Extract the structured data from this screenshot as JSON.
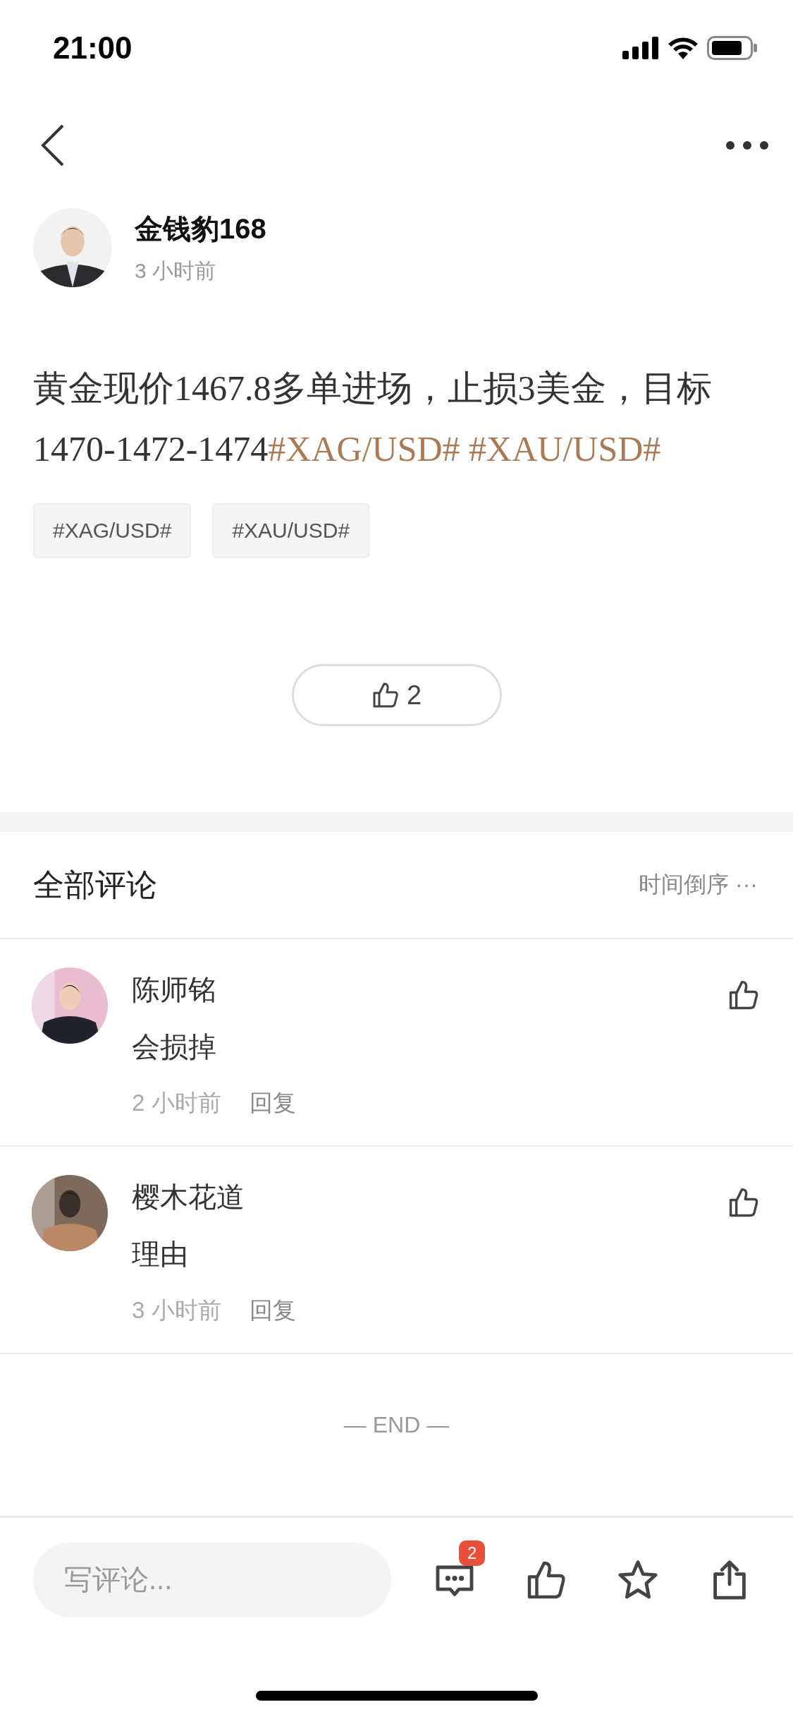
{
  "status_bar": {
    "time": "21:00"
  },
  "author": {
    "name": "金钱豹168",
    "time": "3 小时前"
  },
  "post": {
    "segments": [
      {
        "kind": "plain",
        "text": "黄金现价1467.8多单进场，止损3美金，目标1470-1472-1474"
      },
      {
        "kind": "topic",
        "text": "#XAG/USD#"
      },
      {
        "kind": "topic",
        "text": "#XAU/USD#"
      }
    ],
    "tags": [
      "#XAG/USD#",
      "#XAU/USD#"
    ],
    "likes": "2"
  },
  "comments_header": {
    "title": "全部评论",
    "sort": "时间倒序",
    "more": "···"
  },
  "comments": [
    {
      "name": "陈师铭",
      "text": "会损掉",
      "time": "2 小时前",
      "reply": "回复"
    },
    {
      "name": "樱木花道",
      "text": "理由",
      "time": "3 小时前",
      "reply": "回复"
    }
  ],
  "end_text": "— END —",
  "bottom_bar": {
    "placeholder": "写评论...",
    "comment_badge": "2"
  }
}
